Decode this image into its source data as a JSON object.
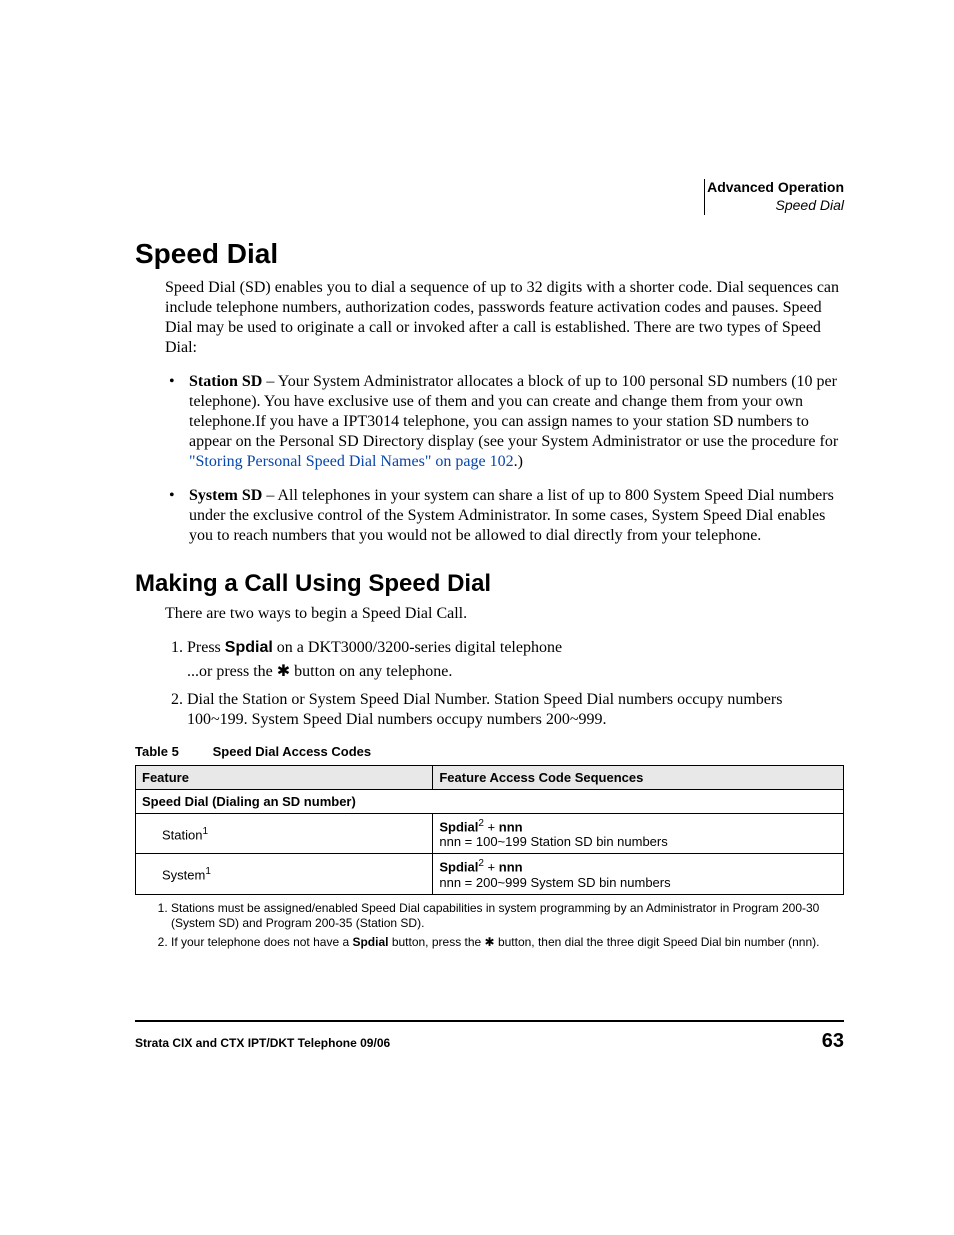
{
  "header": {
    "chapter": "Advanced Operation",
    "section": "Speed Dial"
  },
  "h1": "Speed Dial",
  "intro": "Speed Dial (SD) enables you to dial a sequence of up to 32 digits with a shorter code. Dial sequences can include telephone numbers, authorization codes, passwords feature activation codes and pauses. Speed Dial may be used to originate a call or invoked after a call is established. There are two types of Speed Dial:",
  "bullets": {
    "station_lead": "Station SD",
    "station_rest": " – Your System Administrator allocates a block of up to 100 personal SD numbers (10 per telephone). You have exclusive use of them and you can create and change them from your own telephone.If you have a IPT3014 telephone, you can assign names to your station SD numbers to appear on the Personal SD Directory display (see your System Administrator or use the procedure for ",
    "station_link": "\"Storing Personal Speed Dial Names\" on page 102",
    "station_tail": ".)",
    "system_lead": "System SD",
    "system_rest": " – All telephones in your system can share a list of up to 800 System Speed Dial numbers under the exclusive control of the System Administrator. In some cases, System Speed Dial enables you to reach numbers that you would not be allowed to dial directly from your telephone."
  },
  "h2": "Making a Call Using Speed Dial",
  "intro2": "There are two ways to begin a Speed Dial Call.",
  "steps": {
    "s1a": "Press ",
    "spdial": "Spdial",
    "s1b": " on a DKT3000/3200-series digital telephone",
    "s1c_pre": "...or press the ",
    "s1c_post": " button on any telephone.",
    "s2": "Dial the Station or System Speed Dial Number. Station Speed Dial numbers occupy numbers 100~199. System Speed Dial numbers occupy numbers 200~999."
  },
  "table": {
    "caption_no": "Table 5",
    "caption_title": "Speed Dial Access Codes",
    "head1": "Feature",
    "head2": "Feature Access Code Sequences",
    "subhead": "Speed Dial (Dialing an SD number)",
    "r1_feat": "Station",
    "r1_code_lead": "Spdial",
    "r1_code_mid": " + ",
    "r1_code_nnn": "nnn",
    "r1_desc": "nnn = 100~199 Station SD bin numbers",
    "r2_feat": "System",
    "r2_code_lead": "Spdial",
    "r2_code_mid": " + ",
    "r2_code_nnn": "nnn",
    "r2_desc": "nnn = 200~999 System SD bin numbers"
  },
  "notes": {
    "n1": "Stations must be assigned/enabled Speed Dial capabilities in system programming by an Administrator in Program 200-30 (System SD) and Program 200-35 (Station SD).",
    "n2a": "If your telephone does not have a ",
    "n2b": " button, press the ",
    "n2c": " button, then dial the three digit Speed Dial bin number (nnn)."
  },
  "footer": {
    "left": "Strata CIX and CTX IPT/DKT Telephone    09/06",
    "page": "63"
  },
  "glyph": {
    "star": "✱"
  }
}
